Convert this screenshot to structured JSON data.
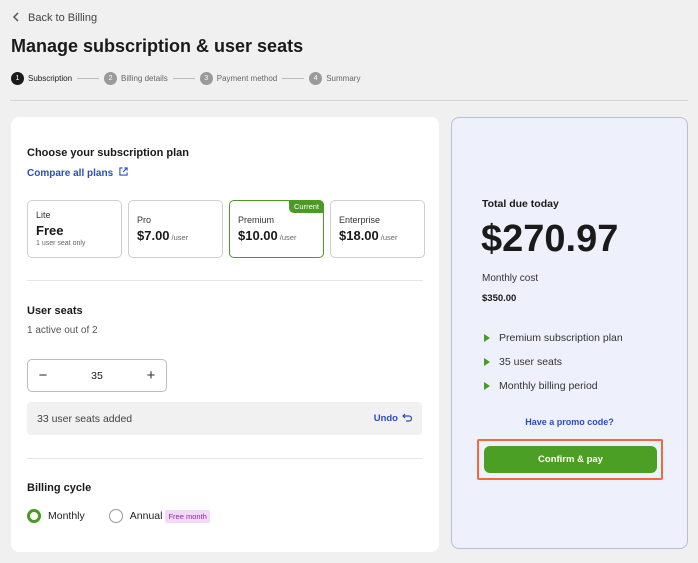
{
  "header": {
    "back_label": "Back to Billing",
    "title": "Manage subscription & user seats"
  },
  "steps": [
    {
      "num": "1",
      "label": "Subscription"
    },
    {
      "num": "2",
      "label": "Billing details"
    },
    {
      "num": "3",
      "label": "Payment method"
    },
    {
      "num": "4",
      "label": "Summary"
    }
  ],
  "plan_section": {
    "title": "Choose your subscription plan",
    "compare_link": "Compare all plans",
    "plans": [
      {
        "name": "Lite",
        "price": "Free",
        "unit": "",
        "note": "1 user seat only"
      },
      {
        "name": "Pro",
        "price": "$7.00",
        "unit": "/user",
        "note": ""
      },
      {
        "name": "Premium",
        "price": "$10.00",
        "unit": "/user",
        "note": "",
        "badge": "Current"
      },
      {
        "name": "Enterprise",
        "price": "$18.00",
        "unit": "/user",
        "note": ""
      }
    ],
    "selected_plan": "Premium"
  },
  "seats_section": {
    "title": "User seats",
    "subtitle": "1 active out of 2",
    "minus": "−",
    "plus": "+",
    "value": "35",
    "added_text": "33 user seats added",
    "undo_label": "Undo"
  },
  "billing_section": {
    "title": "Billing cycle",
    "monthly_label": "Monthly",
    "annual_label": "Annual",
    "free_tag": "Free month",
    "selected": "Monthly"
  },
  "summary": {
    "total_label": "Total due today",
    "total_amount": "$270.97",
    "monthly_cost_label": "Monthly cost",
    "monthly_cost_value": "$350.00",
    "items": [
      "Premium subscription plan",
      "35 user seats",
      "Monthly billing period"
    ],
    "promo_link": "Have a promo code?",
    "confirm_label": "Confirm & pay"
  },
  "colors": {
    "accent_green": "#4c9f25",
    "link_blue": "#2a4dbf",
    "highlight_orange": "#f26a3a",
    "summary_bg": "#eef0fc"
  },
  "icons": {
    "back": "chevron-left-icon",
    "external": "external-link-icon",
    "undo": "undo-arrow-icon",
    "bullet": "triangle-right-icon"
  }
}
